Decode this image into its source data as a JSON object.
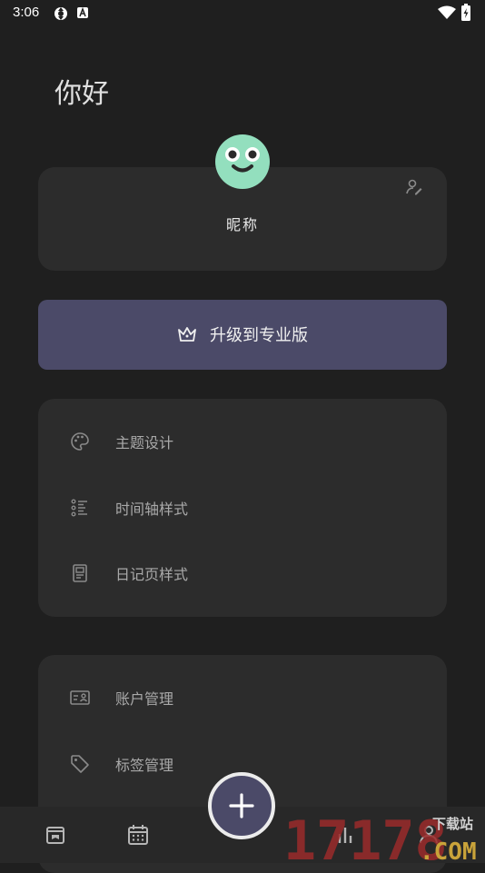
{
  "status": {
    "time": "3:06"
  },
  "greeting": "你好",
  "profile": {
    "nickname": "昵称"
  },
  "upgrade": {
    "label": "升级到专业版"
  },
  "settings": {
    "items": [
      {
        "label": "主题设计",
        "icon": "palette-icon"
      },
      {
        "label": "时间轴样式",
        "icon": "timeline-list-icon"
      },
      {
        "label": "日记页样式",
        "icon": "diary-page-icon"
      }
    ]
  },
  "account": {
    "items": [
      {
        "label": "账户管理",
        "icon": "account-card-icon"
      },
      {
        "label": "标签管理",
        "icon": "tag-icon"
      }
    ]
  },
  "watermark": {
    "number": "17178",
    "site_cn": "下载站",
    "site_en": ".COM"
  },
  "colors": {
    "background": "#1f1f1f",
    "card": "#2c2c2c",
    "accent": "#4b4a68",
    "avatar": "#93dfbe"
  }
}
